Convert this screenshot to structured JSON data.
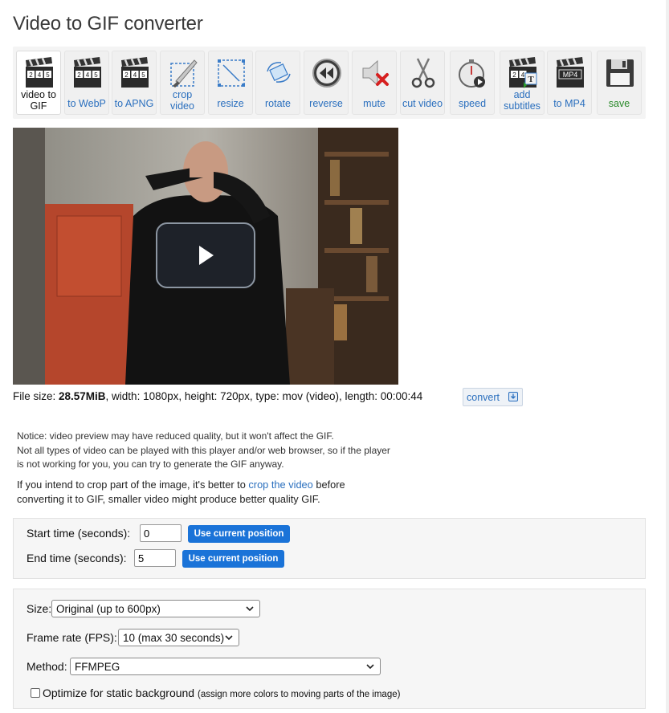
{
  "page": {
    "title": "Video to GIF converter"
  },
  "toolbar": {
    "items": [
      {
        "label": "video to GIF",
        "icon": "clapperboard-245-icon",
        "active": true
      },
      {
        "label": "to WebP",
        "icon": "clapperboard-245-icon"
      },
      {
        "label": "to APNG",
        "icon": "clapperboard-245-icon"
      },
      {
        "label": "crop video",
        "icon": "crop-knife-icon"
      },
      {
        "label": "resize",
        "icon": "resize-icon"
      },
      {
        "label": "rotate",
        "icon": "rotate-icon"
      },
      {
        "label": "reverse",
        "icon": "rewind-icon"
      },
      {
        "label": "mute",
        "icon": "mute-speaker-icon"
      },
      {
        "label": "cut video",
        "icon": "scissors-icon"
      },
      {
        "label": "speed",
        "icon": "stopwatch-icon"
      },
      {
        "label": "add subtitles",
        "icon": "clapperboard-subtitles-icon"
      },
      {
        "label": "to MP4",
        "icon": "clapperboard-mp4-icon",
        "badge": "MP4"
      },
      {
        "label": "save",
        "icon": "floppy-disk-icon"
      }
    ],
    "clapper_digits": "245",
    "subtitle_glyph": "T"
  },
  "video": {
    "play_icon": "play-icon"
  },
  "file_info": {
    "prefix": "File size: ",
    "size": "28.57MiB",
    "rest": ", width: 1080px, height: 720px, type: mov (video), length: 00:00:44",
    "convert_label": "convert"
  },
  "notice": {
    "line1": "Notice: video preview may have reduced quality, but it won't affect the GIF.",
    "line2": "Not all types of video can be played with this player and/or web browser, so if the player",
    "line3": "is not working for you, you can try to generate the GIF anyway.",
    "crop_part1": "If you intend to crop part of the image, it's better to ",
    "crop_link": "crop the video",
    "crop_part2": " before",
    "crop_line2": "converting it to GIF, smaller video might produce better quality GIF."
  },
  "time_panel": {
    "start_label": "Start time (seconds):",
    "start_value": "0",
    "end_label": "End time (seconds):",
    "end_value": "5",
    "use_current_label": "Use current position"
  },
  "options_panel": {
    "size_label": "Size:",
    "size_value": "Original (up to 600px)",
    "fps_label": "Frame rate (FPS):",
    "fps_value": "10 (max 30 seconds)",
    "method_label": "Method:",
    "method_value": "FFMPEG",
    "optimize_label": "Optimize for static background",
    "optimize_note": "(assign more colors to moving parts of the image)",
    "optimize_checked": false
  },
  "colors": {
    "link": "#2a6fbe",
    "button_blue": "#1a73d8",
    "save_green": "#2a8a2a"
  }
}
